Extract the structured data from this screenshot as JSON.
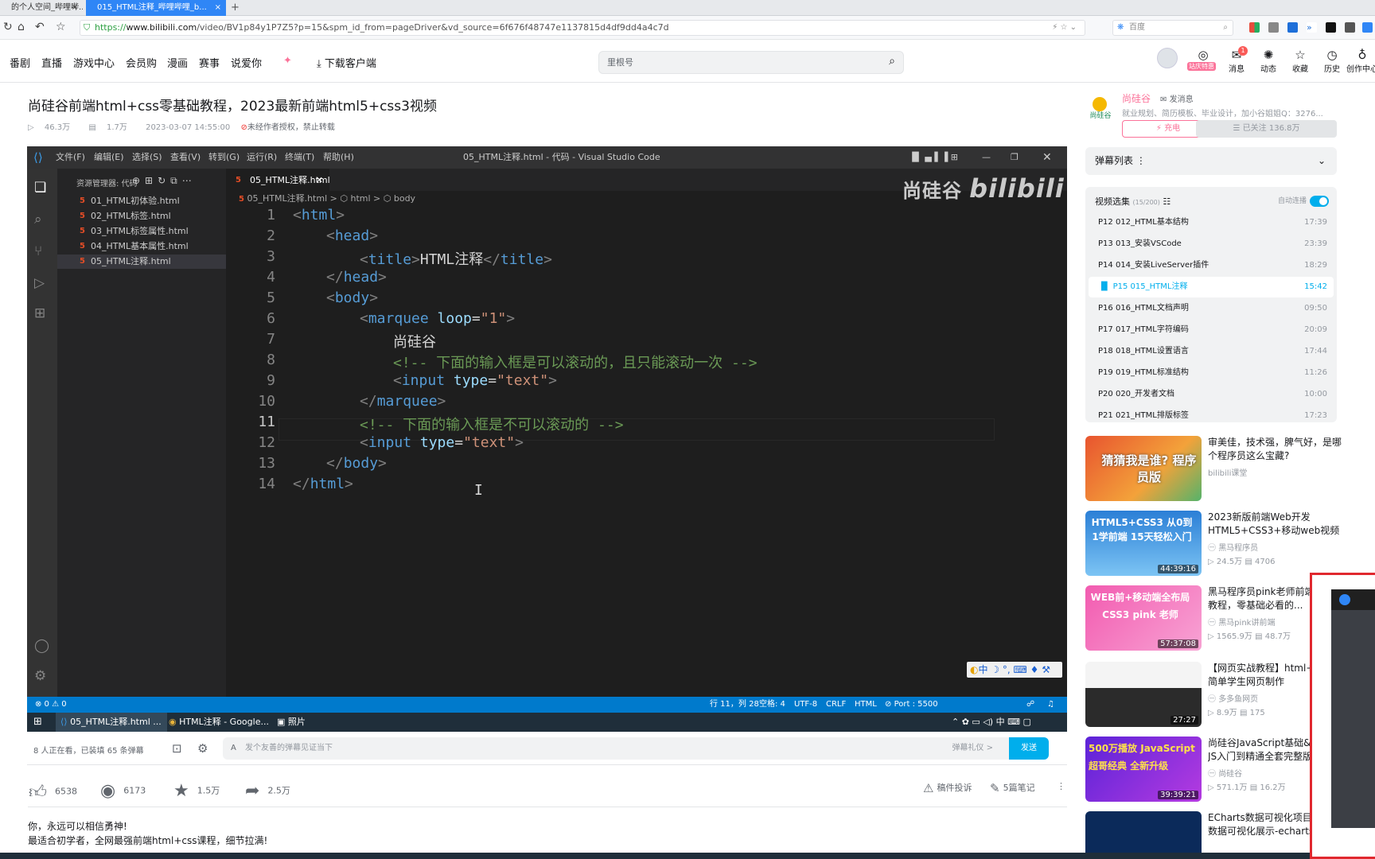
{
  "browser": {
    "tabs": [
      {
        "label": "的个人空间_哔哩哔...",
        "close": "×"
      },
      {
        "label": "015_HTML注释_哔哩哔哩_b...",
        "close": "×"
      }
    ],
    "new_tab": "+",
    "url_scheme": "https://",
    "url_host": "www.bilibili.com",
    "url_path": "/video/BV1p84y1P7Z5?p=15&spm_id_from=pageDriver&vd_source=6f676f48747e1137815d4df9dd4a4c7d",
    "search_placeholder": "百度"
  },
  "site_header": {
    "nav": [
      "番剧",
      "直播",
      "游戏中心",
      "会员购",
      "漫画",
      "赛事",
      "说爱你"
    ],
    "download": "下载客户端",
    "search_placeholder": "里根号",
    "vip_badge": "站庆特惠",
    "message_count": "1",
    "icons": [
      {
        "label": "消息",
        "icon": "message-icon"
      },
      {
        "label": "动态",
        "icon": "dynamic-icon"
      },
      {
        "label": "收藏",
        "icon": "star-icon"
      },
      {
        "label": "历史",
        "icon": "clock-icon"
      },
      {
        "label": "创作中心",
        "icon": "bulb-icon"
      }
    ]
  },
  "video": {
    "title": "尚硅谷前端html+css零基础教程，2023最新前端html5+css3视频",
    "views": "46.3万",
    "danmaku": "1.7万",
    "date": "2023-03-07 14:55:00",
    "notice": "未经作者授权，禁止转载"
  },
  "vscode": {
    "menu": [
      "文件(F)",
      "编辑(E)",
      "选择(S)",
      "查看(V)",
      "转到(G)",
      "运行(R)",
      "终端(T)",
      "帮助(H)"
    ],
    "window_title": "05_HTML注释.html - 代码 - Visual Studio Code",
    "explorer_title": "资源管理器: 代码",
    "files": [
      "01_HTML初体验.html",
      "02_HTML标签.html",
      "03_HTML标签属性.html",
      "04_HTML基本属性.html",
      "05_HTML注释.html"
    ],
    "active_tab": "05_HTML注释.html",
    "breadcrumb": [
      "05_HTML注释.html",
      "html",
      "body"
    ],
    "watermark_cn": "尚硅谷",
    "watermark_en": "bilibili",
    "ime": "中 ☽ °, ⌨ ♦ ⚒",
    "status_left": "⊗ 0 ⚠ 0",
    "status_right": [
      "行 11，列 28",
      "空格: 4",
      "UTF-8",
      "CRLF",
      "HTML",
      "Port : 5500"
    ],
    "taskbar": [
      "05_HTML注释.html ...",
      "HTML注释 - Google...",
      "照片"
    ],
    "taskbar_ime": "中",
    "code_lines": [
      {
        "n": "1"
      },
      {
        "n": "2"
      },
      {
        "n": "3"
      },
      {
        "n": "4"
      },
      {
        "n": "5"
      },
      {
        "n": "6"
      },
      {
        "n": "7"
      },
      {
        "n": "8"
      },
      {
        "n": "9"
      },
      {
        "n": "10"
      },
      {
        "n": "11"
      },
      {
        "n": "12"
      },
      {
        "n": "13"
      },
      {
        "n": "14"
      }
    ],
    "code": {
      "html_open": "html",
      "head_open": "head",
      "title_tag": "title",
      "title_text": "HTML注释",
      "head_close": "head",
      "body_open": "body",
      "marquee": "marquee",
      "loop_attr": "loop",
      "loop_val": "\"1\"",
      "company": "尚硅谷",
      "comment1": "<!-- 下面的输入框是可以滚动的，且只能滚动一次 -->",
      "input1": "input",
      "type_attr": "type",
      "type_val": "\"text\"",
      "marquee_close": "marquee",
      "comment2": "<!-- 下面的输入框是不可以滚动的 -->",
      "input2": "input",
      "body_close": "body",
      "html_close": "html"
    }
  },
  "danmaku_bar": {
    "status": "8 人正在看，已装填 65 条弹幕",
    "placeholder": "发个友善的弹幕见证当下",
    "etiquette": "弹幕礼仪 >",
    "send": "发送"
  },
  "actions": [
    {
      "icon": "like-icon",
      "count": "6538"
    },
    {
      "icon": "coin-icon",
      "count": "6173"
    },
    {
      "icon": "favorite-icon",
      "count": "1.5万"
    },
    {
      "icon": "share-icon",
      "count": "2.5万"
    }
  ],
  "report": "稿件投诉",
  "notes": "5篇笔记",
  "description": [
    "你，永远可以相信勇神!",
    "最适合初学者，全网最强前端html+css课程，细节拉满!"
  ],
  "uploader": {
    "name": "尚硅谷",
    "message": "发消息",
    "desc": "就业规划、简历模板、毕业设计，加小谷姐姐Q：3276...",
    "charge": "充电",
    "followed": "已关注 136.8万",
    "logo_text": "尚硅谷"
  },
  "danmaku_list": "弹幕列表",
  "episodes": {
    "title": "视频选集",
    "count": "(15/200)",
    "autoplay": "自动连播",
    "items": [
      {
        "p": "P12",
        "name": "012_HTML基本结构",
        "dur": "17:39"
      },
      {
        "p": "P13",
        "name": "013_安装VSCode",
        "dur": "23:39"
      },
      {
        "p": "P14",
        "name": "014_安装LiveServer插件",
        "dur": "18:29"
      },
      {
        "p": "P15",
        "name": "015_HTML注释",
        "dur": "15:42"
      },
      {
        "p": "P16",
        "name": "016_HTML文档声明",
        "dur": "09:50"
      },
      {
        "p": "P17",
        "name": "017_HTML字符编码",
        "dur": "20:09"
      },
      {
        "p": "P18",
        "name": "018_HTML设置语言",
        "dur": "17:44"
      },
      {
        "p": "P19",
        "name": "019_HTML标准结构",
        "dur": "11:26"
      },
      {
        "p": "P20",
        "name": "020_开发者文档",
        "dur": "10:00"
      },
      {
        "p": "P21",
        "name": "021_HTML排版标签",
        "dur": "17:23"
      }
    ]
  },
  "recommendations": [
    {
      "title": "审美佳，技术强，脾气好，是哪个程序员这么宝藏?",
      "owner": "bilibili课堂",
      "views": "",
      "dm": "",
      "dur": "",
      "thumb_text": "猜猜我是谁? 程序员版"
    },
    {
      "title": "2023新版前端Web开发HTML5+CSS3+移动web视频教程",
      "owner": "黑马程序员",
      "views": "24.5万",
      "dm": "4706",
      "dur": "44:39:16",
      "thumb_text": "HTML5+CSS3 从0到1学前端 15天轻松入门"
    },
    {
      "title": "黑马程序员pink老师前端入门教程，零基础必看的...",
      "owner": "黑马pink讲前端",
      "views": "1565.9万",
      "dm": "48.7万",
      "dur": "57:37:08",
      "thumb_text": "WEB前+移动端全布局 CSS3 pink 老师"
    },
    {
      "title": "【网页实战教程】html+css 简单学生网页制作",
      "owner": "多多鱼网页",
      "views": "8.9万",
      "dm": "175",
      "dur": "27:27",
      "thumb_text": ""
    },
    {
      "title": "尚硅谷JavaScript基础&实战丨JS入门到精通全套完整版",
      "owner": "尚硅谷",
      "views": "571.1万",
      "dm": "16.2万",
      "dur": "39:39:21",
      "thumb_text": "500万播放 JavaScript 超哥经典 全新升级"
    },
    {
      "title": "ECharts数据可视化项目-大屏数据可视化展示-echarts 图...",
      "owner": "",
      "views": "",
      "dm": "",
      "dur": "",
      "thumb_text": ""
    }
  ],
  "colors": {
    "bili_blue": "#00aeec",
    "bili_pink": "#fb7299",
    "vscode_blue": "#007acc",
    "popup_border": "#e0282e"
  }
}
